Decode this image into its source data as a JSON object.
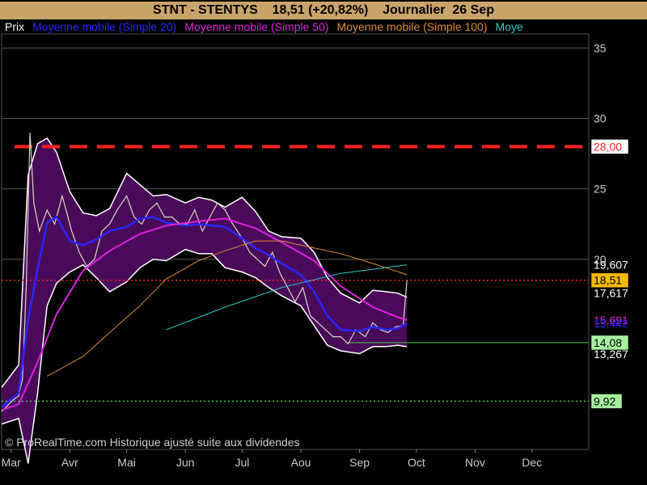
{
  "title": {
    "symbol": "STNT - STENTYS",
    "price_change": "18,51 (+20,82%)",
    "period": "Journalier  26 Sep"
  },
  "legend": {
    "prix": "Prix",
    "items": [
      {
        "label": "Moyenne mobile (Simple 20)",
        "color": "#2828ff"
      },
      {
        "label": "Moyenne mobile (Simple 50)",
        "color": "#e020e0"
      },
      {
        "label": "Moyenne mobile (Simple 100)",
        "color": "#e08a30"
      },
      {
        "label": "Moye",
        "color": "#30c8c8"
      }
    ]
  },
  "watermark": "© ProRealTime.com Historique ajusté suite aux dividendes",
  "colors": {
    "background": "#000000",
    "title_bar": "#c9a46a",
    "band_fill": "#4a0a5a",
    "band_edge": "#ffffff",
    "candle": "#d8d8c0",
    "resistance": "#ff2020",
    "ma20": "#2828ff",
    "ma50": "#e020e0",
    "ma100": "#e08a30",
    "ma200": "#30c8c8"
  },
  "chart_data": {
    "type": "line",
    "ylim": [
      6.5,
      36
    ],
    "xlim": [
      "2012-02-25",
      "2012-12-31"
    ],
    "y_ticks": [
      "35",
      "30",
      "25",
      "20"
    ],
    "x_ticks": [
      {
        "label": "Mar",
        "date": "2012-03-01"
      },
      {
        "label": "Avr",
        "date": "2012-04-01"
      },
      {
        "label": "Mai",
        "date": "2012-05-01"
      },
      {
        "label": "Jun",
        "date": "2012-06-01"
      },
      {
        "label": "Jul",
        "date": "2012-07-01"
      },
      {
        "label": "Aou",
        "date": "2012-08-01"
      },
      {
        "label": "Sep",
        "date": "2012-09-01"
      },
      {
        "label": "Oct",
        "date": "2012-10-01"
      },
      {
        "label": "Nov",
        "date": "2012-11-01"
      },
      {
        "label": "Dec",
        "date": "2012-12-01"
      }
    ],
    "horizontal_lines": [
      {
        "value": 28.0,
        "label": "28,00",
        "style": "dashed",
        "color": "#ff2020",
        "label_bg": "#ffffff",
        "label_fg": "#ff2020"
      },
      {
        "value": 18.51,
        "label": "18,51",
        "style": "dotted",
        "color": "#ff2020",
        "label_bg": "#f5b800",
        "label_fg": "#000000"
      },
      {
        "value": 14.08,
        "label": "14,08",
        "style": "solid",
        "color": "#40d040",
        "label_bg": "#a8f0a0",
        "label_fg": "#000000"
      },
      {
        "value": 9.92,
        "label": "9,92",
        "style": "dotted",
        "color": "#40d040",
        "label_bg": "#a8f0a0",
        "label_fg": "#000000"
      }
    ],
    "value_labels": [
      {
        "value": 19.607,
        "label": "19,607",
        "color": "#ffffff"
      },
      {
        "value": 17.617,
        "label": "17,617",
        "color": "#ffffff"
      },
      {
        "value": 15.691,
        "label": "15,691",
        "color": "#e020e0"
      },
      {
        "value": 15.442,
        "label": "15,442",
        "color": "#2828ff"
      },
      {
        "value": 13.267,
        "label": "13,267",
        "color": "#ffffff"
      }
    ],
    "bollinger": {
      "x": [
        "2012-02-25",
        "2012-03-05",
        "2012-03-10",
        "2012-03-15",
        "2012-03-20",
        "2012-03-25",
        "2012-04-01",
        "2012-04-08",
        "2012-04-15",
        "2012-04-22",
        "2012-05-01",
        "2012-05-08",
        "2012-05-15",
        "2012-05-22",
        "2012-06-01",
        "2012-06-08",
        "2012-06-15",
        "2012-06-22",
        "2012-07-01",
        "2012-07-08",
        "2012-07-15",
        "2012-07-22",
        "2012-08-01",
        "2012-08-08",
        "2012-08-15",
        "2012-08-22",
        "2012-09-01",
        "2012-09-08",
        "2012-09-15",
        "2012-09-21",
        "2012-09-26"
      ],
      "upper": [
        10.9,
        12.5,
        26.0,
        28.2,
        28.6,
        27.6,
        24.8,
        23.3,
        23.1,
        23.6,
        26.1,
        25.3,
        24.5,
        24.6,
        24.0,
        24.4,
        24.2,
        23.7,
        24.4,
        23.4,
        22.0,
        21.6,
        21.5,
        20.5,
        18.7,
        17.6,
        16.9,
        17.8,
        17.7,
        17.6,
        17.3
      ],
      "lower": [
        8.3,
        8.7,
        5.5,
        10.5,
        16.7,
        18.3,
        19.1,
        19.6,
        18.7,
        17.7,
        18.4,
        19.4,
        20.0,
        19.9,
        20.7,
        20.4,
        20.4,
        19.4,
        19.1,
        18.7,
        18.0,
        17.4,
        16.7,
        15.3,
        13.9,
        13.5,
        13.3,
        13.8,
        13.8,
        13.9,
        13.8
      ]
    },
    "series": [
      {
        "name": "Moyenne mobile (Simple 20)",
        "color": "#2828ff",
        "x": [
          "2012-02-25",
          "2012-03-05",
          "2012-03-10",
          "2012-03-15",
          "2012-03-20",
          "2012-03-25",
          "2012-04-01",
          "2012-04-08",
          "2012-04-15",
          "2012-04-22",
          "2012-05-01",
          "2012-05-08",
          "2012-05-15",
          "2012-05-22",
          "2012-06-01",
          "2012-06-08",
          "2012-06-15",
          "2012-06-22",
          "2012-07-01",
          "2012-07-08",
          "2012-07-15",
          "2012-07-22",
          "2012-08-01",
          "2012-08-08",
          "2012-08-15",
          "2012-08-22",
          "2012-09-01",
          "2012-09-08",
          "2012-09-15",
          "2012-09-21",
          "2012-09-26"
        ],
        "y": [
          9.5,
          10.5,
          15.7,
          19.3,
          22.6,
          23.0,
          21.3,
          21.0,
          21.4,
          22.0,
          22.3,
          22.9,
          23.0,
          22.6,
          22.4,
          22.5,
          22.4,
          22.3,
          21.5,
          20.8,
          20.3,
          19.7,
          18.9,
          17.7,
          16.0,
          15.0,
          14.9,
          15.2,
          15.0,
          15.1,
          15.44
        ]
      },
      {
        "name": "Moyenne mobile (Simple 50)",
        "color": "#e020e0",
        "x": [
          "2012-02-25",
          "2012-03-05",
          "2012-03-15",
          "2012-03-25",
          "2012-04-08",
          "2012-04-22",
          "2012-05-08",
          "2012-05-22",
          "2012-06-08",
          "2012-06-22",
          "2012-07-08",
          "2012-07-22",
          "2012-08-08",
          "2012-08-22",
          "2012-09-08",
          "2012-09-21",
          "2012-09-26"
        ],
        "y": [
          9.3,
          9.7,
          12.7,
          16.1,
          19.2,
          20.6,
          21.8,
          22.4,
          22.7,
          22.9,
          22.2,
          21.2,
          19.9,
          18.1,
          16.6,
          15.9,
          15.69
        ]
      },
      {
        "name": "Moyenne mobile (Simple 100)",
        "color": "#e08a30",
        "x": [
          "2012-03-20",
          "2012-04-08",
          "2012-04-22",
          "2012-05-08",
          "2012-05-22",
          "2012-06-08",
          "2012-06-22",
          "2012-07-08",
          "2012-07-22",
          "2012-08-08",
          "2012-08-22",
          "2012-09-08",
          "2012-09-26"
        ],
        "y": [
          11.7,
          13.1,
          14.8,
          16.7,
          18.6,
          19.9,
          20.6,
          21.3,
          21.3,
          20.8,
          20.4,
          19.7,
          18.9
        ]
      },
      {
        "name": "Moye",
        "color": "#30c8c8",
        "x": [
          "2012-05-22",
          "2012-06-22",
          "2012-07-22",
          "2012-08-22",
          "2012-09-26"
        ],
        "y": [
          15.0,
          16.6,
          18.0,
          19.0,
          19.61
        ]
      }
    ],
    "price": {
      "x": [
        "2012-02-25",
        "2012-03-02",
        "2012-03-05",
        "2012-03-07",
        "2012-03-09",
        "2012-03-11",
        "2012-03-13",
        "2012-03-16",
        "2012-03-20",
        "2012-03-24",
        "2012-03-28",
        "2012-04-02",
        "2012-04-06",
        "2012-04-10",
        "2012-04-14",
        "2012-04-18",
        "2012-04-22",
        "2012-04-26",
        "2012-05-01",
        "2012-05-05",
        "2012-05-09",
        "2012-05-13",
        "2012-05-17",
        "2012-05-21",
        "2012-05-25",
        "2012-05-29",
        "2012-06-02",
        "2012-06-06",
        "2012-06-10",
        "2012-06-14",
        "2012-06-18",
        "2012-06-22",
        "2012-06-26",
        "2012-07-01",
        "2012-07-05",
        "2012-07-09",
        "2012-07-13",
        "2012-07-17",
        "2012-07-21",
        "2012-07-25",
        "2012-07-29",
        "2012-08-02",
        "2012-08-06",
        "2012-08-10",
        "2012-08-14",
        "2012-08-18",
        "2012-08-22",
        "2012-08-26",
        "2012-08-30",
        "2012-09-04",
        "2012-09-08",
        "2012-09-12",
        "2012-09-16",
        "2012-09-20",
        "2012-09-24",
        "2012-09-26"
      ],
      "y": [
        9.2,
        10.0,
        10.3,
        11.5,
        18.0,
        29.0,
        24.0,
        22.0,
        23.5,
        22.5,
        24.5,
        22.0,
        20.5,
        19.5,
        20.0,
        22.0,
        22.5,
        23.5,
        24.5,
        23.0,
        22.5,
        23.5,
        24.0,
        23.0,
        23.0,
        22.5,
        22.5,
        23.5,
        22.0,
        23.0,
        24.0,
        23.5,
        22.5,
        21.5,
        20.5,
        20.0,
        19.5,
        20.5,
        19.0,
        18.0,
        17.0,
        18.0,
        16.0,
        15.5,
        15.0,
        14.5,
        14.5,
        14.0,
        15.0,
        14.5,
        15.5,
        15.0,
        14.8,
        15.2,
        15.3,
        18.51
      ]
    }
  }
}
